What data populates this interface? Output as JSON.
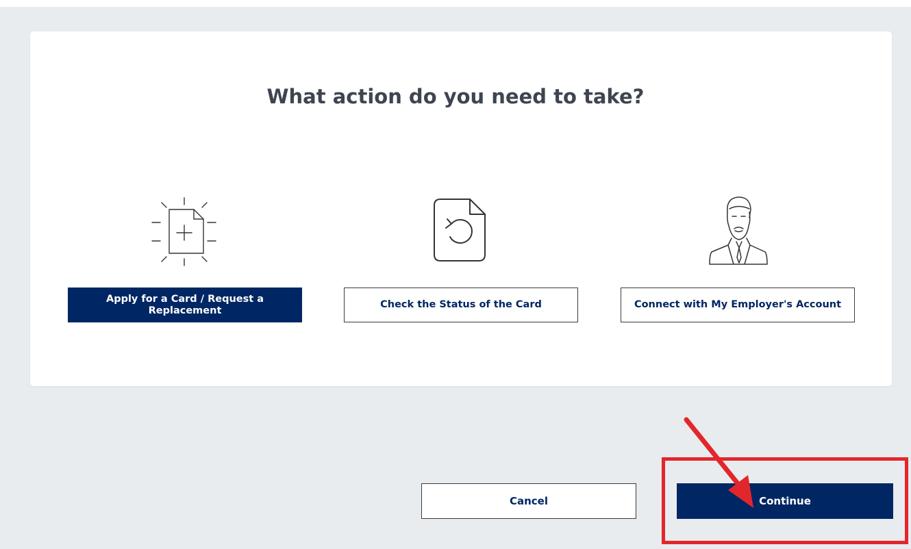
{
  "page": {
    "heading": "What action do you need to take?"
  },
  "options": [
    {
      "label": "Apply for a Card / Request a Replacement",
      "icon": "new-document-icon",
      "selected": true
    },
    {
      "label": "Check the Status of the Card",
      "icon": "document-refresh-icon",
      "selected": false
    },
    {
      "label": "Connect with My Employer's Account",
      "icon": "employer-person-icon",
      "selected": false
    }
  ],
  "actions": {
    "cancel_label": "Cancel",
    "continue_label": "Continue"
  },
  "annotation": {
    "arrow_icon": "red-arrow-icon",
    "color": "#e3262b"
  },
  "colors": {
    "primary": "#002663",
    "heading": "#3e4550",
    "background": "#e9ecef"
  }
}
